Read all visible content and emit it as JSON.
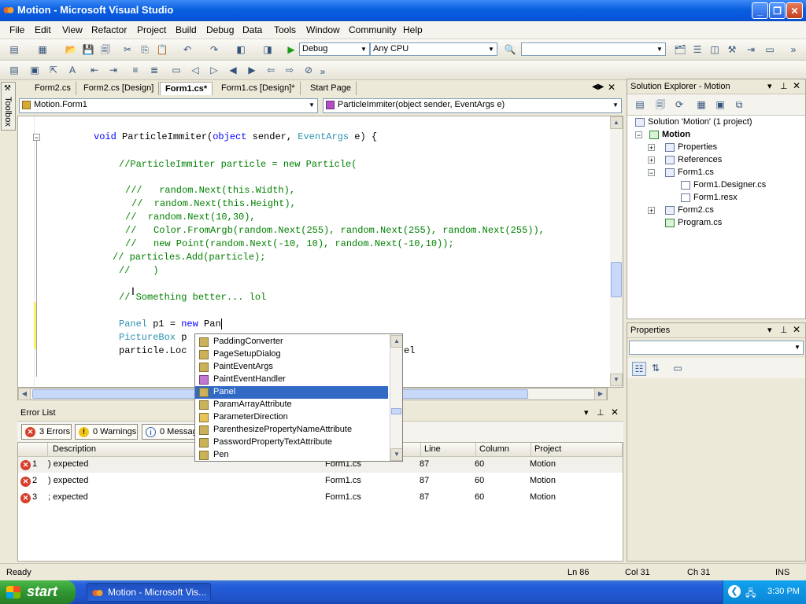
{
  "window": {
    "title": "Motion - Microsoft Visual Studio"
  },
  "menu": [
    "File",
    "Edit",
    "View",
    "Refactor",
    "Project",
    "Build",
    "Debug",
    "Data",
    "Tools",
    "Window",
    "Community",
    "Help"
  ],
  "toolbar": {
    "config": "Debug",
    "platform": "Any CPU",
    "find": ""
  },
  "toolbox": {
    "label": "Toolbox"
  },
  "tabs": [
    {
      "label": "Form2.cs"
    },
    {
      "label": "Form2.cs [Design]"
    },
    {
      "label": "Form1.cs*"
    },
    {
      "label": "Form1.cs [Design]*"
    },
    {
      "label": "Start Page"
    }
  ],
  "nav": {
    "class_combo": "Motion.Form1",
    "member_combo": "ParticleImmiter(object sender, EventArgs e)"
  },
  "code": {
    "l1": {
      "a": "void ",
      "b": "ParticleImmiter(",
      "c": "object",
      "d": " sender, ",
      "e": "EventArgs",
      "f": " e) {"
    },
    "l2": "//ParticleImmiter particle = new Particle(",
    "l3": "///   random.Next(this.Width),",
    "l4": "//  random.Next(this.Height),",
    "l5": "//  random.Next(10,30),",
    "l6": "//   Color.FromArgb(random.Next(255), random.Next(255), random.Next(255)),",
    "l7": "//   new Point(random.Next(-10, 10), random.Next(-10,10));",
    "l8": "// particles.Add(particle);",
    "l9": "//    )",
    "l10": "// Something better... lol",
    "l11": {
      "a": "Panel",
      "b": " p1 = ",
      "c": "new",
      "d": " Pan"
    },
    "l12": {
      "a": "PictureBox",
      "b": " p"
    },
    "l13": {
      "a": "particle.Loc",
      "b": "el"
    }
  },
  "intellisense": [
    "PaddingConverter",
    "PageSetupDialog",
    "PaintEventArgs",
    "PaintEventHandler",
    "Panel",
    "ParamArrayAttribute",
    "ParameterDirection",
    "ParenthesizePropertyNameAttribute",
    "PasswordPropertyTextAttribute",
    "Pen"
  ],
  "error_list": {
    "title": "Error List",
    "errors_btn": "3 Errors",
    "warnings_btn": "0 Warnings",
    "messages_btn": "0 Messag",
    "columns": {
      "description": "Description",
      "line": "Line",
      "column": "Column",
      "project": "Project"
    },
    "rows": [
      {
        "n": "1",
        "desc": ") expected",
        "file": "Form1.cs",
        "line": "87",
        "col": "60",
        "project": "Motion"
      },
      {
        "n": "2",
        "desc": ") expected",
        "file": "Form1.cs",
        "line": "87",
        "col": "60",
        "project": "Motion"
      },
      {
        "n": "3",
        "desc": "; expected",
        "file": "Form1.cs",
        "line": "87",
        "col": "60",
        "project": "Motion"
      }
    ]
  },
  "solution": {
    "title": "Solution Explorer - Motion",
    "root": "Solution 'Motion' (1 project)",
    "project": "Motion",
    "items": [
      "Properties",
      "References",
      "Form1.cs",
      "Form1.Designer.cs",
      "Form1.resx",
      "Form2.cs",
      "Program.cs"
    ]
  },
  "properties": {
    "title": "Properties"
  },
  "status": {
    "ready": "Ready",
    "ln": "Ln 86",
    "col": "Col 31",
    "ch": "Ch 31",
    "ins": "INS"
  },
  "taskbar": {
    "start": "start",
    "item": "Motion - Microsoft Vis...",
    "time": "3:30 PM"
  }
}
